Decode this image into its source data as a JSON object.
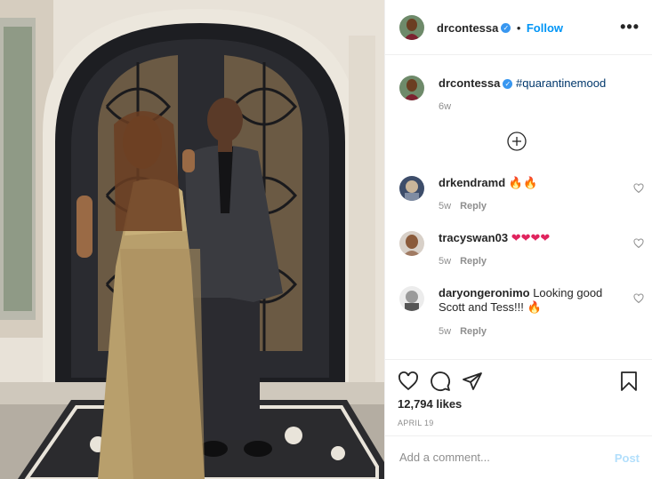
{
  "post": {
    "username": "drcontessa",
    "follow_label": "Follow",
    "menu_glyph": "•••"
  },
  "caption": {
    "username": "drcontessa",
    "hashtag": "#quarantinemood",
    "age": "6w"
  },
  "comments": [
    {
      "username": "drkendramd",
      "text": "🔥🔥",
      "age": "5w",
      "reply_label": "Reply"
    },
    {
      "username": "tracyswan03",
      "text": "❤❤❤❤",
      "age": "5w",
      "reply_label": "Reply"
    },
    {
      "username": "daryongeronimo",
      "text": "Looking good Scott and Tess!!! 🔥",
      "age": "5w",
      "reply_label": "Reply"
    }
  ],
  "stats": {
    "likes": "12,794 likes",
    "date": "APRIL 19"
  },
  "add_comment": {
    "placeholder": "Add a comment...",
    "post_label": "Post"
  },
  "colors": {
    "accent": "#0095f6",
    "verified": "#3897f0",
    "post_disabled": "#b2dffc",
    "text": "#262626",
    "muted": "#8e8e8e"
  },
  "icons": [
    "more-options-icon",
    "verified-badge-icon",
    "load-more-icon",
    "heart-icon",
    "comment-icon",
    "share-icon",
    "bookmark-icon"
  ]
}
